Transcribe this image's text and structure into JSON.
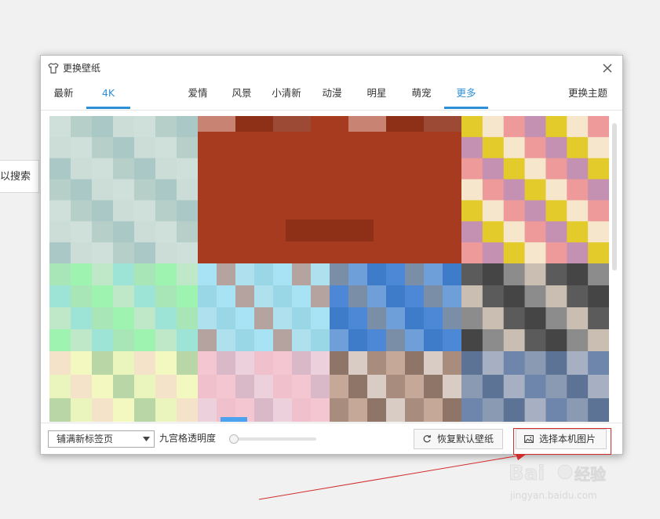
{
  "background": {
    "search_hint": "以搜索"
  },
  "dialog": {
    "title": "更换壁纸",
    "icons": {
      "title": "tshirt-icon",
      "close": "close-icon"
    },
    "tabs": [
      {
        "label": "最新",
        "active": false
      },
      {
        "label": "4K",
        "active": true
      },
      {
        "label": "爱情",
        "active": false
      },
      {
        "label": "风景",
        "active": false
      },
      {
        "label": "小清新",
        "active": false
      },
      {
        "label": "动漫",
        "active": false
      },
      {
        "label": "明星",
        "active": false
      },
      {
        "label": "萌宠",
        "active": false
      },
      {
        "label": "更多",
        "active": true
      }
    ],
    "theme_link": "更换主题",
    "thumbnails": [
      {
        "name": "thumbnail-1",
        "colors": [
          "#cfe0db",
          "#b6cfc9",
          "#aac8c6",
          "#ccdcd6"
        ]
      },
      {
        "name": "thumbnail-2",
        "colors": [
          "#a73b1f",
          "#c98373",
          "#8e3018",
          "#9c4a36"
        ]
      },
      {
        "name": "thumbnail-3",
        "colors": [
          "#ee9a9a",
          "#c491b2",
          "#e2cb2a",
          "#f5e6cc"
        ]
      },
      {
        "name": "thumbnail-4",
        "colors": [
          "#9ef3b1",
          "#bfe8c9",
          "#9de3d6",
          "#a8e6b8"
        ]
      },
      {
        "name": "thumbnail-5",
        "colors": [
          "#a7e3f5",
          "#b5a39f",
          "#aee0ee",
          "#9ad7e6"
        ]
      },
      {
        "name": "thumbnail-6",
        "colors": [
          "#4c88d6",
          "#7a8ea8",
          "#6f9fd8",
          "#3e7bc9"
        ]
      },
      {
        "name": "thumbnail-7",
        "colors": [
          "#8c8c8c",
          "#c9beb1",
          "#5b5b5b",
          "#454545"
        ]
      },
      {
        "name": "thumbnail-8",
        "colors": [
          "#f2f8c0",
          "#b8d6a6",
          "#e9f5bc",
          "#f4e2c9"
        ]
      },
      {
        "name": "thumbnail-9",
        "colors": [
          "#f4c6d2",
          "#d9b8c8",
          "#ecd0db",
          "#f0c0cc"
        ]
      },
      {
        "name": "thumbnail-10",
        "colors": [
          "#c6a898",
          "#8f7468",
          "#d8ccc5",
          "#a88c7e"
        ]
      },
      {
        "name": "thumbnail-11",
        "colors": [
          "#6e86ab",
          "#8a9ab2",
          "#5d7396",
          "#a6b0c2"
        ]
      }
    ],
    "bottom": {
      "fill_mode": "铺满新标签页",
      "opacity_label": "九宫格透明度",
      "opacity_value": 0.0,
      "restore_button": "恢复默认壁纸",
      "choose_button": "选择本机图片",
      "icons": {
        "restore": "undo-icon",
        "choose": "image-icon"
      }
    }
  },
  "watermark": {
    "logo": "Baidu经验",
    "url": "jingyan.baidu.com"
  },
  "colors": {
    "accent": "#2d8fd6",
    "annotation_red": "#d12b2b"
  }
}
